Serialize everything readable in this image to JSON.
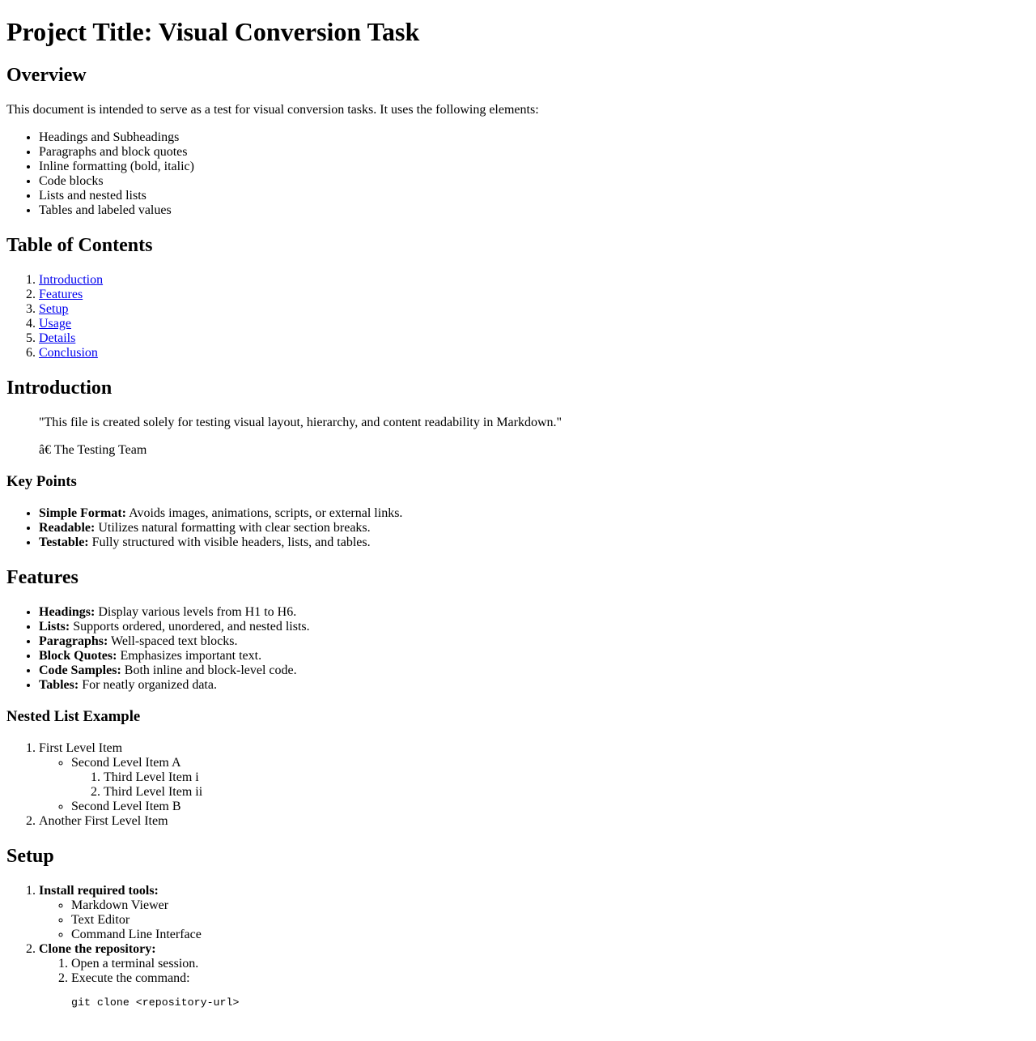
{
  "title": "Project Title: Visual Conversion Task",
  "overview": {
    "heading": "Overview",
    "intro": "This document is intended to serve as a test for visual conversion tasks. It uses the following elements:",
    "items": [
      "Headings and Subheadings",
      "Paragraphs and block quotes",
      "Inline formatting (bold, italic)",
      "Code blocks",
      "Lists and nested lists",
      "Tables and labeled values"
    ]
  },
  "toc": {
    "heading": "Table of Contents",
    "links": [
      "Introduction",
      "Features",
      "Setup",
      "Usage",
      "Details",
      "Conclusion"
    ]
  },
  "introduction": {
    "heading": "Introduction",
    "quote": "\"This file is created solely for testing visual layout, hierarchy, and content readability in Markdown.\"",
    "attribution": "â€ The Testing Team"
  },
  "key_points": {
    "heading": "Key Points",
    "items": [
      {
        "label": "Simple Format:",
        "text": " Avoids images, animations, scripts, or external links."
      },
      {
        "label": "Readable:",
        "text": " Utilizes natural formatting with clear section breaks."
      },
      {
        "label": "Testable:",
        "text": " Fully structured with visible headers, lists, and tables."
      }
    ]
  },
  "features": {
    "heading": "Features",
    "items": [
      {
        "label": "Headings:",
        "text": " Display various levels from H1 to H6."
      },
      {
        "label": "Lists:",
        "text": " Supports ordered, unordered, and nested lists."
      },
      {
        "label": "Paragraphs:",
        "text": " Well-spaced text blocks."
      },
      {
        "label": "Block Quotes:",
        "text": " Emphasizes important text."
      },
      {
        "label": "Code Samples:",
        "text": " Both inline and block-level code."
      },
      {
        "label": "Tables:",
        "text": " For neatly organized data."
      }
    ]
  },
  "nested": {
    "heading": "Nested List Example",
    "first": "First Level Item",
    "second_a": "Second Level Item A",
    "third_i": "Third Level Item i",
    "third_ii": "Third Level Item ii",
    "second_b": "Second Level Item B",
    "another_first": "Another First Level Item"
  },
  "setup": {
    "heading": "Setup",
    "step1": "Install required tools:",
    "tools": [
      "Markdown Viewer",
      "Text Editor",
      "Command Line Interface"
    ],
    "step2": "Clone the repository:",
    "substeps": [
      "Open a terminal session.",
      "Execute the command:"
    ],
    "code": "git clone <repository-url>"
  }
}
